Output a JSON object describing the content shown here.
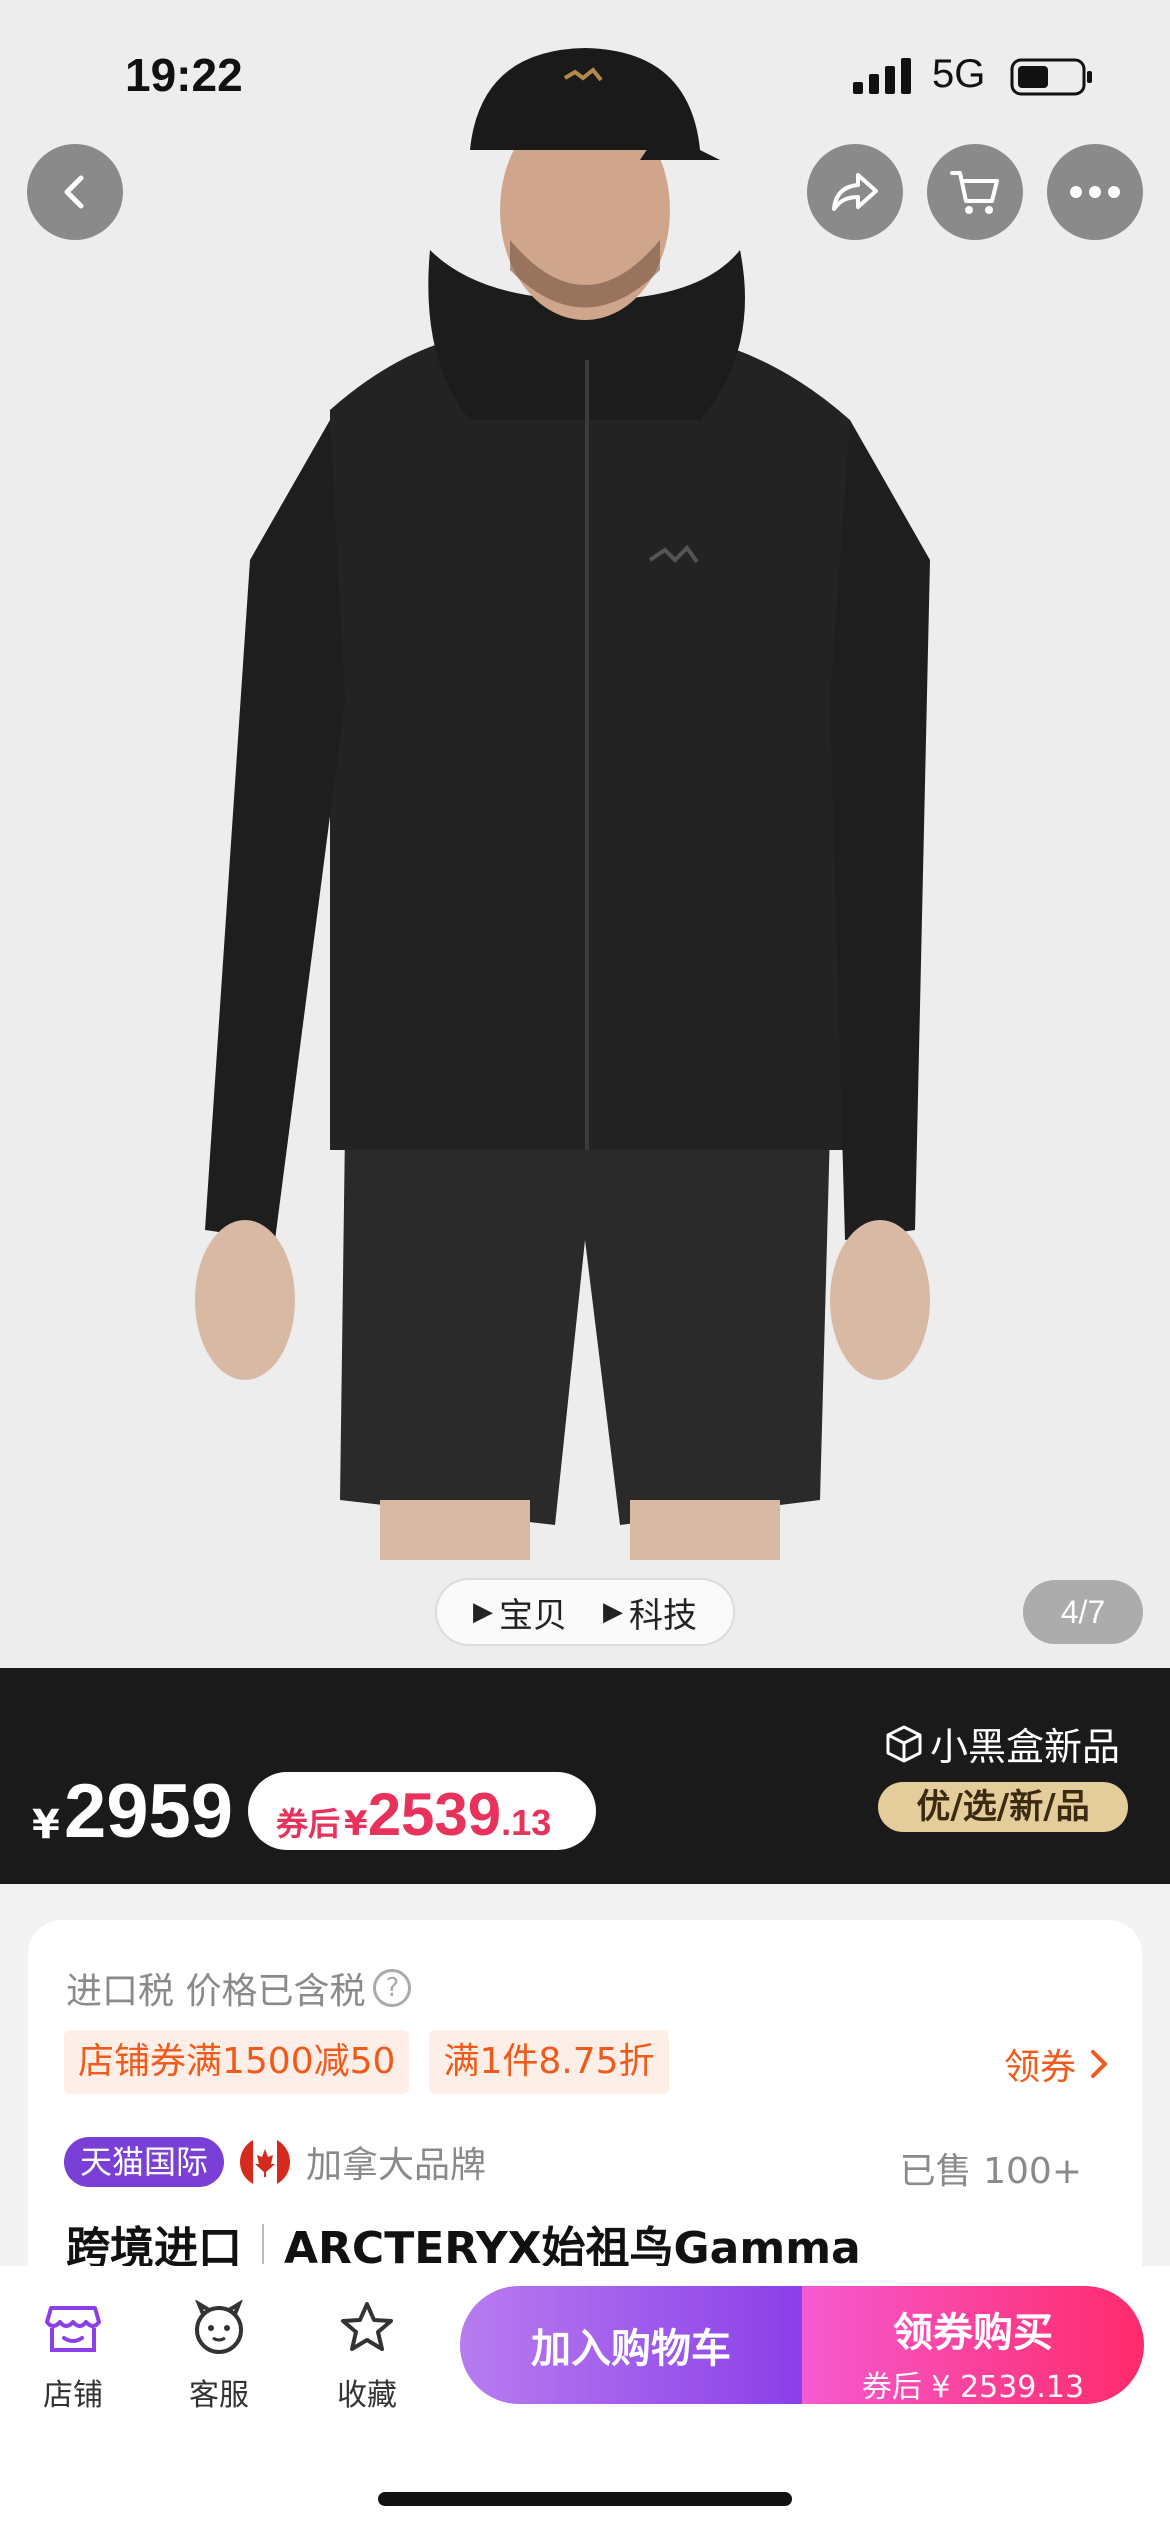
{
  "status_bar": {
    "time": "19:22",
    "network": "5G"
  },
  "header_buttons": [
    "back-icon",
    "share-icon",
    "cart-icon",
    "more-icon"
  ],
  "media": {
    "tabs": [
      {
        "label": "宝贝"
      },
      {
        "label": "科技"
      }
    ],
    "counter": "4/7"
  },
  "price": {
    "currency": "¥",
    "original": "2959",
    "coupon_label": "券后",
    "coupon_currency": "¥",
    "coupon_int": "2539",
    "coupon_dec": ".13",
    "blackbox_title": "小黑盒新品",
    "blackbox_tag": "优/选/新/品"
  },
  "info": {
    "tax_text": "进口税 价格已含税",
    "help_glyph": "?",
    "promos": [
      "店铺券满1500减50",
      "满1件8.75折"
    ],
    "coupon_link": "领券",
    "platform_badge": "天猫国际",
    "brand_origin": "加拿大品牌",
    "sold": "已售 100+",
    "title_prefix": "跨境进口",
    "title": "ARCTERYX始祖鸟Gamma"
  },
  "bottom_nav": {
    "store": "店铺",
    "service": "客服",
    "favorite": "收藏",
    "add_to_cart": "加入购物车",
    "buy_main": "领券购买",
    "buy_sub": "券后 ¥ 2539.13"
  },
  "colors": {
    "accent_purple": "#8a3fe8",
    "accent_pink": "#ff2a6a",
    "price_red": "#e8315b",
    "promo_orange": "#f05a1a"
  }
}
